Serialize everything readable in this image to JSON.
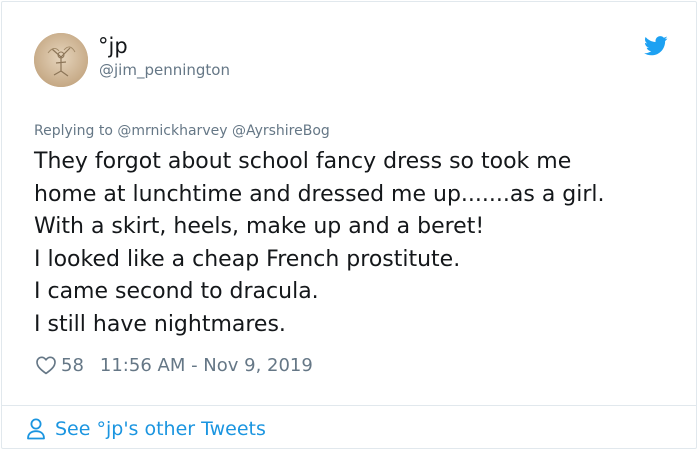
{
  "tweet": {
    "author": {
      "display_name": "°jp",
      "handle": "@jim_pennington",
      "avatar_icon": "avatar-sketch"
    },
    "platform_icon": "twitter-bird-icon",
    "replying_to": {
      "prefix": "Replying to",
      "mentions": [
        "@mrnickharvey",
        "@AyrshireBog"
      ]
    },
    "text_lines": [
      "They forgot about school fancy dress so took me",
      "home at lunchtime and dressed me up.......as a girl.",
      "With a skirt, heels, make up and a beret!",
      "I looked like a cheap French prostitute.",
      "I came second to dracula.",
      "I still have nightmares."
    ],
    "likes": "58",
    "timestamp": "11:56 AM - Nov 9, 2019"
  },
  "footer": {
    "see_more_label": "See °jp's other Tweets",
    "icon": "person-icon"
  },
  "colors": {
    "text": "#14171a",
    "secondary": "#657786",
    "accent": "#1b95e0",
    "border": "#e1e8ed"
  }
}
